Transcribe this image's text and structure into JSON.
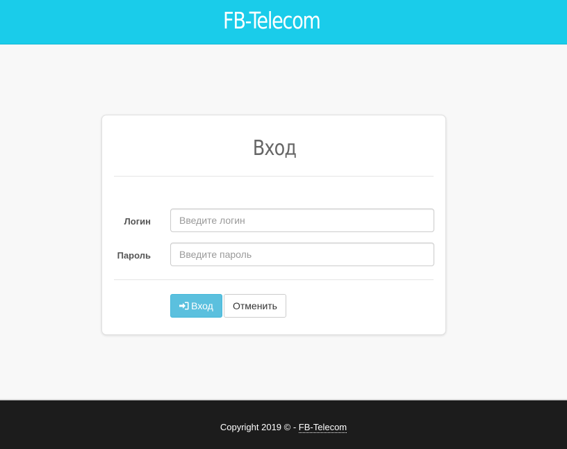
{
  "header": {
    "brand": "FB-Telecom"
  },
  "login_form": {
    "title": "Вход",
    "login_label": "Логин",
    "login_placeholder": "Введите логин",
    "password_label": "Пароль",
    "password_placeholder": "Введите пароль",
    "submit_label": "Вход",
    "submit_icon": "sign-in-icon",
    "cancel_label": "Отменить"
  },
  "footer": {
    "copyright_text": "Copyright 2019 © - ",
    "link_text": "FB-Telecom"
  },
  "colors": {
    "navbar": "#1accea",
    "login_button": "#5bc0de",
    "footer": "#1c1c1c",
    "page_background": "#f8f8f8"
  }
}
